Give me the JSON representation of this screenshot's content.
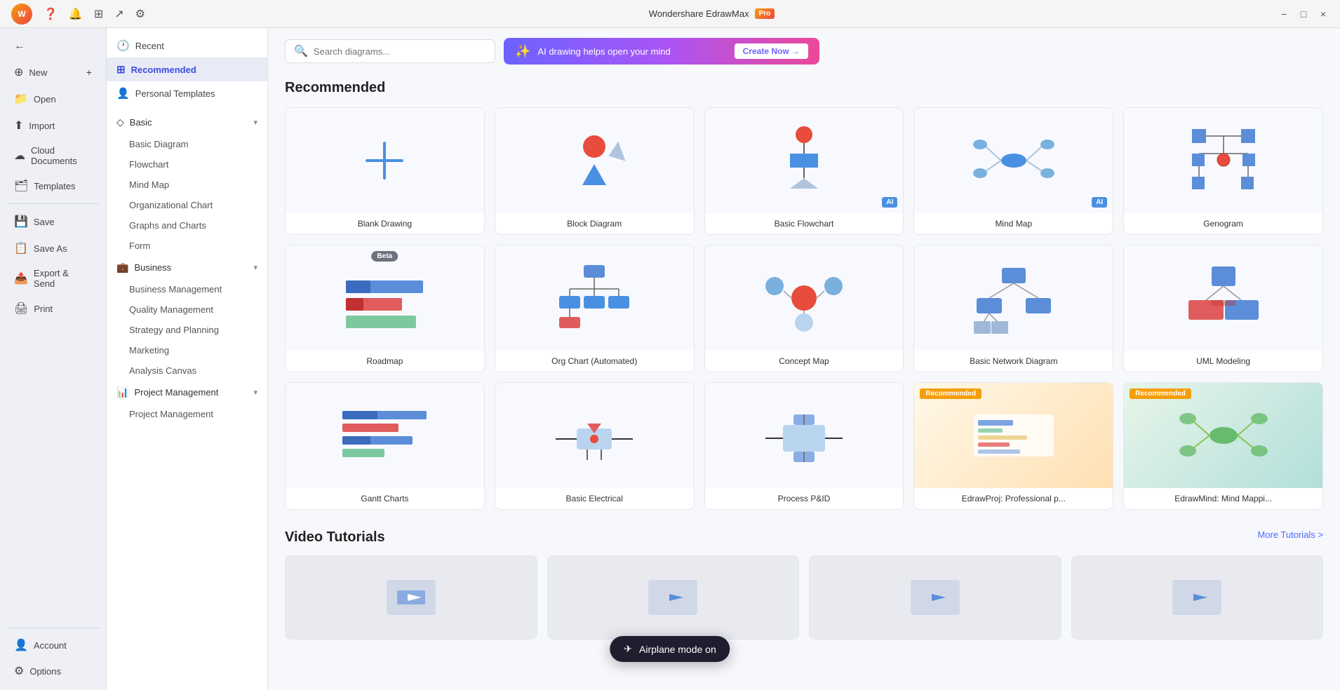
{
  "app": {
    "title": "Wondershare EdrawMax",
    "pro_badge": "Pro"
  },
  "titlebar": {
    "minimize": "−",
    "maximize": "□",
    "close": "×",
    "avatar_initials": "W"
  },
  "sidebar": {
    "back_label": "←",
    "items": [
      {
        "id": "new",
        "label": "New",
        "icon": "⊕"
      },
      {
        "id": "open",
        "label": "Open",
        "icon": "📁"
      },
      {
        "id": "import",
        "label": "Import",
        "icon": "⬆"
      },
      {
        "id": "cloud",
        "label": "Cloud Documents",
        "icon": "☁"
      },
      {
        "id": "templates",
        "label": "Templates",
        "icon": "🗂"
      },
      {
        "id": "save",
        "label": "Save",
        "icon": "💾"
      },
      {
        "id": "saveas",
        "label": "Save As",
        "icon": "📋"
      },
      {
        "id": "export",
        "label": "Export & Send",
        "icon": "📤"
      },
      {
        "id": "print",
        "label": "Print",
        "icon": "🖨"
      }
    ],
    "bottom_items": [
      {
        "id": "account",
        "label": "Account",
        "icon": "👤"
      },
      {
        "id": "options",
        "label": "Options",
        "icon": "⚙"
      }
    ]
  },
  "nav": {
    "recent_label": "Recent",
    "recommended_label": "Recommended",
    "personal_templates_label": "Personal Templates",
    "basic_label": "Basic",
    "basic_items": [
      "Basic Diagram",
      "Flowchart",
      "Mind Map",
      "Organizational Chart",
      "Graphs and Charts",
      "Form"
    ],
    "business_label": "Business",
    "business_items": [
      "Business Management",
      "Quality Management",
      "Strategy and Planning",
      "Marketing",
      "Analysis Canvas"
    ],
    "project_label": "Project Management",
    "project_items": [
      "Project Management"
    ]
  },
  "search": {
    "placeholder": "Search diagrams..."
  },
  "ai_banner": {
    "text": "AI drawing helps open your mind",
    "btn": "Create Now →"
  },
  "main": {
    "section_title": "Recommended",
    "templates": [
      {
        "id": "blank",
        "label": "Blank Drawing",
        "type": "blank",
        "badge": ""
      },
      {
        "id": "block",
        "label": "Block Diagram",
        "type": "block",
        "badge": ""
      },
      {
        "id": "flowchart",
        "label": "Basic Flowchart",
        "type": "flowchart",
        "badge": "AI"
      },
      {
        "id": "mindmap",
        "label": "Mind Map",
        "type": "mindmap",
        "badge": "AI"
      },
      {
        "id": "genogram",
        "label": "Genogram",
        "type": "genogram",
        "badge": ""
      },
      {
        "id": "roadmap",
        "label": "Roadmap",
        "type": "roadmap",
        "badge": "Beta"
      },
      {
        "id": "orgchart",
        "label": "Org Chart (Automated)",
        "type": "orgchart",
        "badge": ""
      },
      {
        "id": "concept",
        "label": "Concept Map",
        "type": "concept",
        "badge": ""
      },
      {
        "id": "network",
        "label": "Basic Network Diagram",
        "type": "network",
        "badge": ""
      },
      {
        "id": "uml",
        "label": "UML Modeling",
        "type": "uml",
        "badge": ""
      },
      {
        "id": "gantt",
        "label": "Gantt Charts",
        "type": "gantt",
        "badge": ""
      },
      {
        "id": "electrical",
        "label": "Basic Electrical",
        "type": "electrical",
        "badge": ""
      },
      {
        "id": "pid",
        "label": "Process P&ID",
        "type": "pid",
        "badge": ""
      },
      {
        "id": "edrawproj",
        "label": "EdrawProj: Professional p...",
        "type": "edrawproj",
        "badge": "Recommended"
      },
      {
        "id": "edrawmind",
        "label": "EdrawMind: Mind Mappi...",
        "type": "edrawmind",
        "badge": "Recommended"
      }
    ],
    "tutorials_title": "Video Tutorials",
    "more_tutorials": "More Tutorials >"
  },
  "toast": {
    "icon": "✈",
    "text": "Airplane mode on"
  }
}
